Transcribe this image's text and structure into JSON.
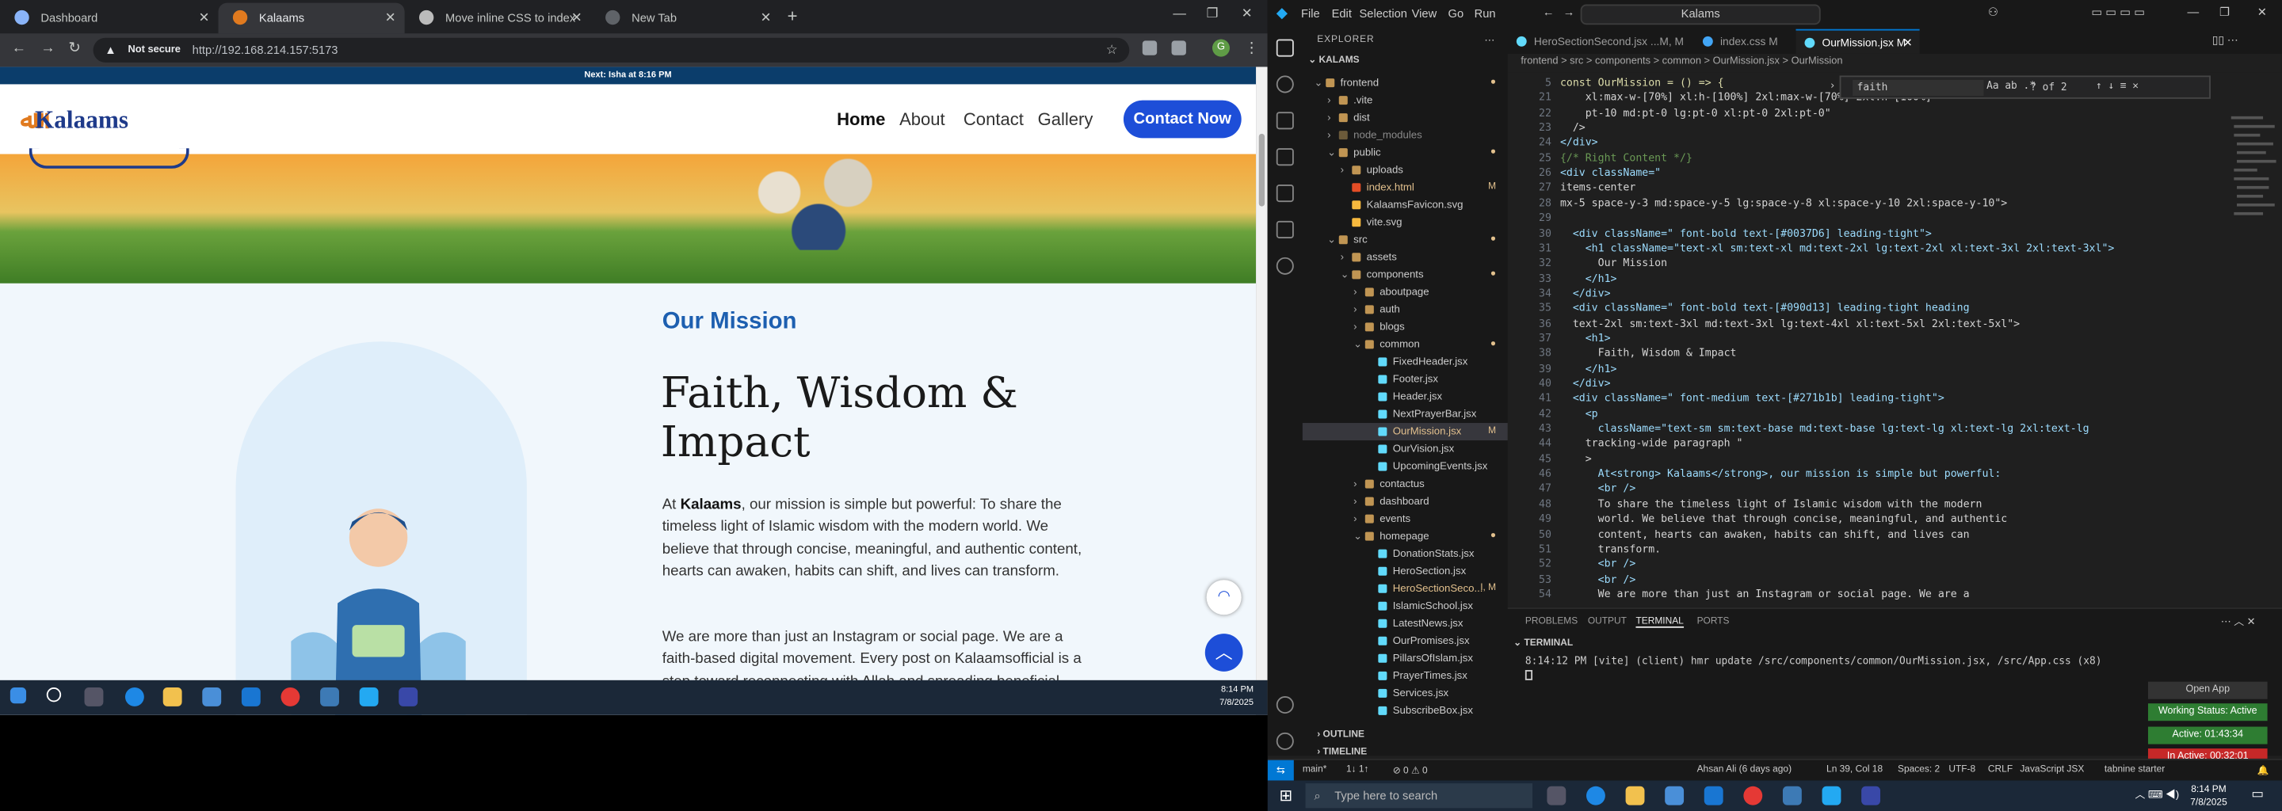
{
  "browser": {
    "tabs": [
      {
        "label": "Dashboard",
        "active": false
      },
      {
        "label": "Kalaams",
        "active": true
      },
      {
        "label": "Move inline CSS to index",
        "active": false
      },
      {
        "label": "New Tab",
        "active": false
      }
    ],
    "not_secure_label": "Not secure",
    "url": "http://192.168.214.157:5173",
    "profile_initial": "G"
  },
  "site": {
    "prayer_bar_text": "Next: Isha at 8:16 PM",
    "logo_text": "Kalaams",
    "nav": [
      "Home",
      "About",
      "Contact",
      "Gallery"
    ],
    "cta_label": "Contact Now",
    "kicker": "Our Mission",
    "heading": "Faith, Wisdom & Impact",
    "para1_prefix": "At ",
    "para1_brand": "Kalaams",
    "para1_rest": ", our mission is simple but powerful: To share the timeless light of Islamic wisdom with the modern world. We believe that through concise, meaningful, and authentic content, hearts can awaken, habits can shift, and lives can transform.",
    "para2": "We are more than just an Instagram or social page. We are a faith-based digital movement. Every post on Kalaamsofficial is a step toward reconnecting with Allah and spreading beneficial"
  },
  "left_taskbar": {
    "time": "8:14 PM",
    "date": "7/8/2025"
  },
  "vscode": {
    "menu": [
      "File",
      "Edit",
      "Selection",
      "View",
      "Go",
      "Run"
    ],
    "command_center": "Kalams",
    "explorer_title": "EXPLORER",
    "project": "KALAMS",
    "tree": [
      {
        "label": "frontend",
        "depth": 0,
        "type": "folder-open",
        "badge": "●"
      },
      {
        "label": ".vite",
        "depth": 1,
        "type": "folder",
        "badge": ""
      },
      {
        "label": "dist",
        "depth": 1,
        "type": "folder",
        "badge": ""
      },
      {
        "label": "node_modules",
        "depth": 1,
        "type": "folder-dim",
        "badge": ""
      },
      {
        "label": "public",
        "depth": 1,
        "type": "folder-open",
        "badge": "●"
      },
      {
        "label": "uploads",
        "depth": 2,
        "type": "folder",
        "badge": ""
      },
      {
        "label": "index.html",
        "depth": 2,
        "type": "html",
        "badge": "M"
      },
      {
        "label": "KalaamsFavicon.svg",
        "depth": 2,
        "type": "svg",
        "badge": ""
      },
      {
        "label": "vite.svg",
        "depth": 2,
        "type": "svg",
        "badge": ""
      },
      {
        "label": "src",
        "depth": 1,
        "type": "folder-open",
        "badge": "●"
      },
      {
        "label": "assets",
        "depth": 2,
        "type": "folder",
        "badge": ""
      },
      {
        "label": "components",
        "depth": 2,
        "type": "folder-open",
        "badge": "●"
      },
      {
        "label": "aboutpage",
        "depth": 3,
        "type": "folder",
        "badge": ""
      },
      {
        "label": "auth",
        "depth": 3,
        "type": "folder",
        "badge": ""
      },
      {
        "label": "blogs",
        "depth": 3,
        "type": "folder",
        "badge": ""
      },
      {
        "label": "common",
        "depth": 3,
        "type": "folder-open",
        "badge": "●"
      },
      {
        "label": "FixedHeader.jsx",
        "depth": 4,
        "type": "jsx",
        "badge": ""
      },
      {
        "label": "Footer.jsx",
        "depth": 4,
        "type": "jsx",
        "badge": ""
      },
      {
        "label": "Header.jsx",
        "depth": 4,
        "type": "jsx",
        "badge": ""
      },
      {
        "label": "NextPrayerBar.jsx",
        "depth": 4,
        "type": "jsx",
        "badge": ""
      },
      {
        "label": "OurMission.jsx",
        "depth": 4,
        "type": "jsx",
        "badge": "M",
        "selected": true
      },
      {
        "label": "OurVision.jsx",
        "depth": 4,
        "type": "jsx",
        "badge": ""
      },
      {
        "label": "UpcomingEvents.jsx",
        "depth": 4,
        "type": "jsx",
        "badge": ""
      },
      {
        "label": "contactus",
        "depth": 3,
        "type": "folder",
        "badge": ""
      },
      {
        "label": "dashboard",
        "depth": 3,
        "type": "folder",
        "badge": ""
      },
      {
        "label": "events",
        "depth": 3,
        "type": "folder",
        "badge": ""
      },
      {
        "label": "homepage",
        "depth": 3,
        "type": "folder-open",
        "badge": "●"
      },
      {
        "label": "DonationStats.jsx",
        "depth": 4,
        "type": "jsx",
        "badge": ""
      },
      {
        "label": "HeroSection.jsx",
        "depth": 4,
        "type": "jsx",
        "badge": ""
      },
      {
        "label": "HeroSectionSeco...",
        "depth": 4,
        "type": "jsx",
        "badge": "I, M"
      },
      {
        "label": "IslamicSchool.jsx",
        "depth": 4,
        "type": "jsx",
        "badge": ""
      },
      {
        "label": "LatestNews.jsx",
        "depth": 4,
        "type": "jsx",
        "badge": ""
      },
      {
        "label": "OurPromises.jsx",
        "depth": 4,
        "type": "jsx",
        "badge": ""
      },
      {
        "label": "PillarsOfIslam.jsx",
        "depth": 4,
        "type": "jsx",
        "badge": ""
      },
      {
        "label": "PrayerTimes.jsx",
        "depth": 4,
        "type": "jsx",
        "badge": ""
      },
      {
        "label": "Services.jsx",
        "depth": 4,
        "type": "jsx",
        "badge": ""
      },
      {
        "label": "SubscribeBox.jsx",
        "depth": 4,
        "type": "jsx",
        "badge": ""
      }
    ],
    "outline_label": "OUTLINE",
    "timeline_label": "TIMELINE",
    "editor_tabs": [
      {
        "label": "HeroSectionSecond.jsx ...M, M",
        "active": false
      },
      {
        "label": "index.css M",
        "active": false
      },
      {
        "label": "OurMission.jsx M",
        "active": true
      }
    ],
    "breadcrumb": "frontend > src > components > common > OurMission.jsx > OurMission",
    "find_query": "faith",
    "find_count": "? of 2",
    "code_lines": [
      {
        "n": "5",
        "t": "const OurMission = () => {"
      },
      {
        "n": "21",
        "t": "    xl:max-w-[70%] xl:h-[100%] 2xl:max-w-[70%] 2xl:h-[100%]"
      },
      {
        "n": "22",
        "t": "    pt-10 md:pt-0 lg:pt-0 xl:pt-0 2xl:pt-0\""
      },
      {
        "n": "23",
        "t": "  />"
      },
      {
        "n": "24",
        "t": "</div>"
      },
      {
        "n": "25",
        "t": "{/* Right Content */}"
      },
      {
        "n": "26",
        "t": "<div className=\""
      },
      {
        "n": "27",
        "t": "items-center"
      },
      {
        "n": "28",
        "t": "mx-5 space-y-3 md:space-y-5 lg:space-y-8 xl:space-y-10 2xl:space-y-10\">"
      },
      {
        "n": "29",
        "t": ""
      },
      {
        "n": "30",
        "t": "  <div className=\" font-bold text-[#0037D6] leading-tight\">"
      },
      {
        "n": "31",
        "t": "    <h1 className=\"text-xl sm:text-xl md:text-2xl lg:text-2xl xl:text-3xl 2xl:text-3xl\">"
      },
      {
        "n": "32",
        "t": "      Our Mission"
      },
      {
        "n": "33",
        "t": "    </h1>"
      },
      {
        "n": "34",
        "t": "  </div>"
      },
      {
        "n": "35",
        "t": "  <div className=\" font-bold text-[#090d13] leading-tight heading"
      },
      {
        "n": "36",
        "t": "  text-2xl sm:text-3xl md:text-3xl lg:text-4xl xl:text-5xl 2xl:text-5xl\">"
      },
      {
        "n": "37",
        "t": "    <h1>"
      },
      {
        "n": "38",
        "t": "      Faith, Wisdom & Impact"
      },
      {
        "n": "39",
        "t": "    </h1>"
      },
      {
        "n": "40",
        "t": "  </div>"
      },
      {
        "n": "41",
        "t": "  <div className=\" font-medium text-[#271b1b] leading-tight\">"
      },
      {
        "n": "42",
        "t": "    <p"
      },
      {
        "n": "43",
        "t": "      className=\"text-sm sm:text-base md:text-base lg:text-lg xl:text-lg 2xl:text-lg"
      },
      {
        "n": "44",
        "t": "    tracking-wide paragraph \""
      },
      {
        "n": "45",
        "t": "    >"
      },
      {
        "n": "46",
        "t": "      At<strong> Kalaams</strong>, our mission is simple but powerful:"
      },
      {
        "n": "47",
        "t": "      <br />"
      },
      {
        "n": "48",
        "t": "      To share the timeless light of Islamic wisdom with the modern"
      },
      {
        "n": "49",
        "t": "      world. We believe that through concise, meaningful, and authentic"
      },
      {
        "n": "50",
        "t": "      content, hearts can awaken, habits can shift, and lives can"
      },
      {
        "n": "51",
        "t": "      transform."
      },
      {
        "n": "52",
        "t": "      <br />"
      },
      {
        "n": "53",
        "t": "      <br />"
      },
      {
        "n": "54",
        "t": "      We are more than just an Instagram or social page. We are a"
      }
    ],
    "panel_tabs": [
      "PROBLEMS",
      "OUTPUT",
      "TERMINAL",
      "PORTS"
    ],
    "terminal_title": "TERMINAL",
    "terminal_line": "8:14:12 PM [vite] (client) hmr update /src/components/common/OurMission.jsx, /src/App.css (x8)",
    "wakatime": {
      "open_app": "Open App",
      "status": "Working Status: Active",
      "active": "Active: 01:43:34",
      "inactive": "In Active: 00:32:01"
    },
    "status": {
      "branch": "main*",
      "sync": "1↓ 1↑",
      "problems": "⊘ 0 ⚠ 0",
      "blame": "Ahsan Ali (6 days ago)",
      "position": "Ln 39, Col 18",
      "spaces": "Spaces: 2",
      "encoding": "UTF-8",
      "eol": "CRLF",
      "language": "JavaScript JSX",
      "tabnine": "tabnine starter"
    }
  },
  "right_taskbar": {
    "search_placeholder": "Type here to search",
    "time": "8:14 PM",
    "date": "7/8/2025"
  }
}
